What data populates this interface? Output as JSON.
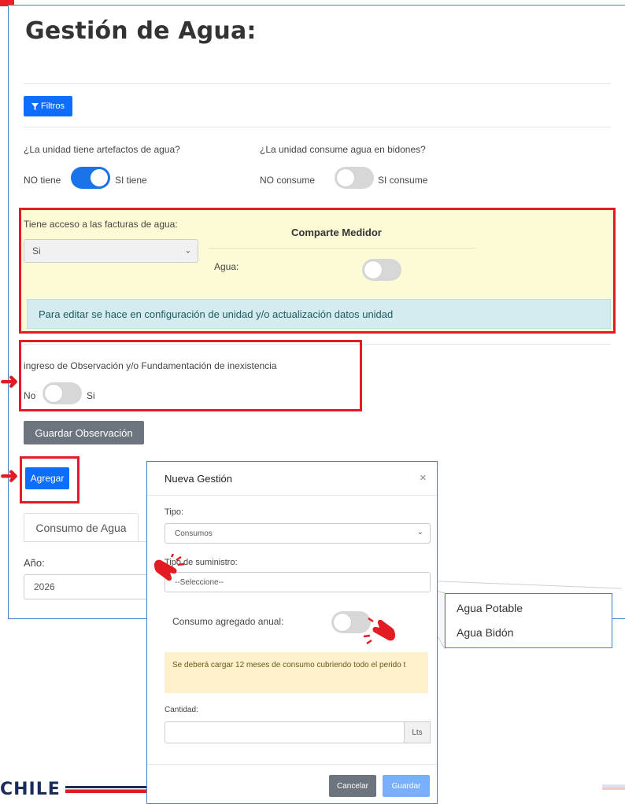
{
  "page": {
    "title": "Gestión de Agua:"
  },
  "filters": {
    "button_label": "Filtros",
    "icon": "funnel-icon"
  },
  "water_devices": {
    "question": "¿La unidad tiene artefactos de agua?",
    "off_label": "NO tiene",
    "on_label": "SI tiene",
    "value": true
  },
  "water_bottles": {
    "question": "¿La unidad consume agua en bidones?",
    "off_label": "NO consume",
    "on_label": "SI consume",
    "value": false
  },
  "invoice_section": {
    "label": "Tiene acceso a las facturas de agua:",
    "select_value": "Si",
    "share_meter_title": "Comparte Medidor",
    "water_label": "Agua:",
    "water_toggle": false,
    "info_text": "Para editar se hace en configuración de unidad y/o actualización datos unidad"
  },
  "observation": {
    "label": "ingreso de Observación y/o Fundamentación de inexistencia",
    "off_label": "No",
    "on_label": "Si",
    "value": false,
    "save_button": "Guardar Observación"
  },
  "add_button": "Agregar",
  "tabs": [
    {
      "label": "Consumo de Agua",
      "active": true
    }
  ],
  "year": {
    "label": "Año:",
    "value": "2026"
  },
  "modal": {
    "title": "Nueva Gestión",
    "close": "×",
    "tipo_label": "Tipo:",
    "tipo_value": "Consumos",
    "supply_label": "Tipo de suministro:",
    "supply_value": "--Seleccione--",
    "annual_label": "Consumo agregado anual:",
    "annual_toggle": false,
    "warning": "Se deberá cargar 12 meses de consumo cubriendo todo el perido t",
    "amount_label": "Cantidad:",
    "amount_value": "",
    "amount_unit": "Lts",
    "cancel": "Cancelar",
    "save": "Guardar"
  },
  "supply_options": [
    "Agua Potable",
    "Agua Bidón"
  ],
  "footer": {
    "brand": "CHILE"
  },
  "colors": {
    "primary": "#0d6efd",
    "highlight_border": "#e31b23",
    "panel_border": "#4a7fc1",
    "yellow_bg": "#fdfbd6",
    "info_bg": "#d4ecef",
    "warning_bg": "#fdf1cc"
  }
}
